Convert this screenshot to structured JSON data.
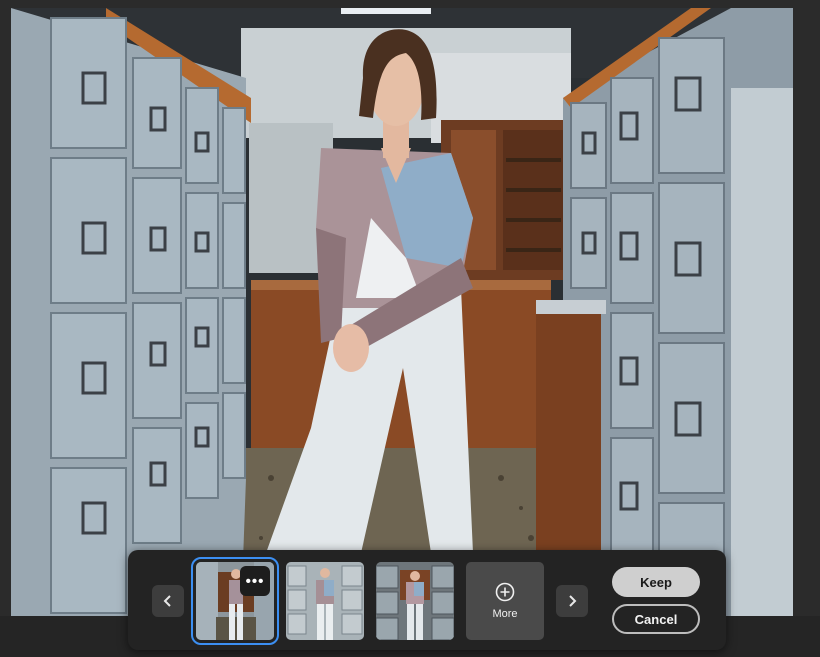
{
  "variation_bar": {
    "prev_icon": "chevron-left-icon",
    "next_icon": "chevron-right-icon",
    "thumbnails": [
      {
        "selected": true,
        "menu_label": "•••",
        "menu_icon": "ellipsis-icon"
      },
      {
        "selected": false
      },
      {
        "selected": false
      }
    ],
    "more": {
      "label": "More",
      "icon": "plus-circle-icon"
    },
    "keep_label": "Keep",
    "cancel_label": "Cancel"
  },
  "colors": {
    "selection_outline": "#3c8ff2",
    "panel_background": "#232323",
    "keep_button": "#cfcfcf"
  }
}
